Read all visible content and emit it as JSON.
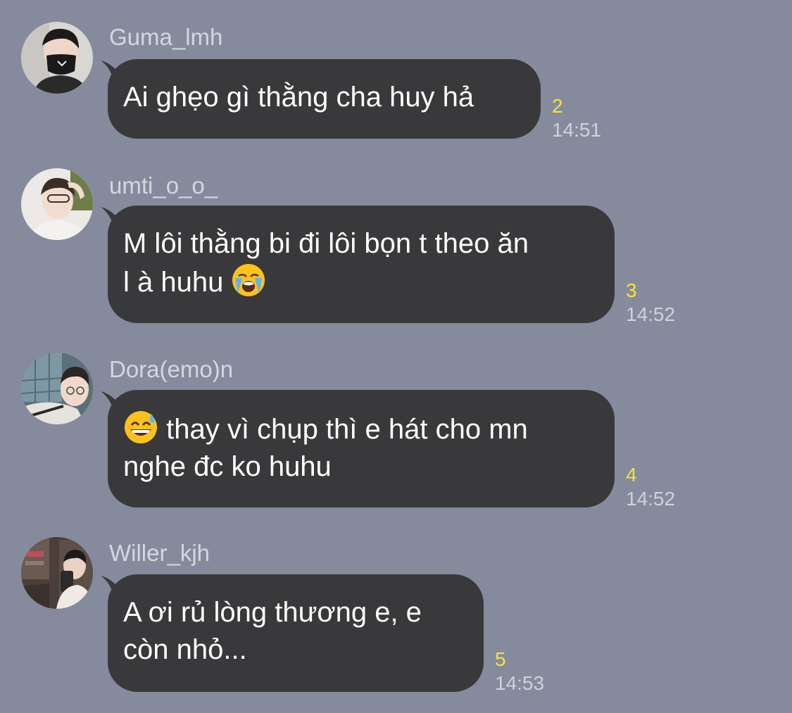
{
  "messages": [
    {
      "sender": "Guma_lmh",
      "lines": [
        "Ai ghẹo gì thằng cha huy hả"
      ],
      "read_count": "2",
      "time": "14:51"
    },
    {
      "sender": "umti_o_o_",
      "lines": [
        "M lôi thằng bi đi lôi bọn t theo ăn",
        "l à huhu"
      ],
      "read_count": "3",
      "time": "14:52",
      "emoji": "loudly-crying-face"
    },
    {
      "sender": "Dora(emo)n",
      "lines": [
        "thay vì chụp thì e hát cho mn",
        "nghe đc ko huhu"
      ],
      "read_count": "4",
      "time": "14:52",
      "emoji": "grinning-face-with-sweat"
    },
    {
      "sender": "Willer_kjh",
      "lines": [
        "A ơi rủ lòng thương e, e",
        "còn nhỏ..."
      ],
      "read_count": "5",
      "time": "14:53"
    }
  ],
  "colors": {
    "background": "#858b9c",
    "bubble": "#39393b",
    "read_count": "#f7e13c",
    "timestamp": "#cfd2d9"
  }
}
